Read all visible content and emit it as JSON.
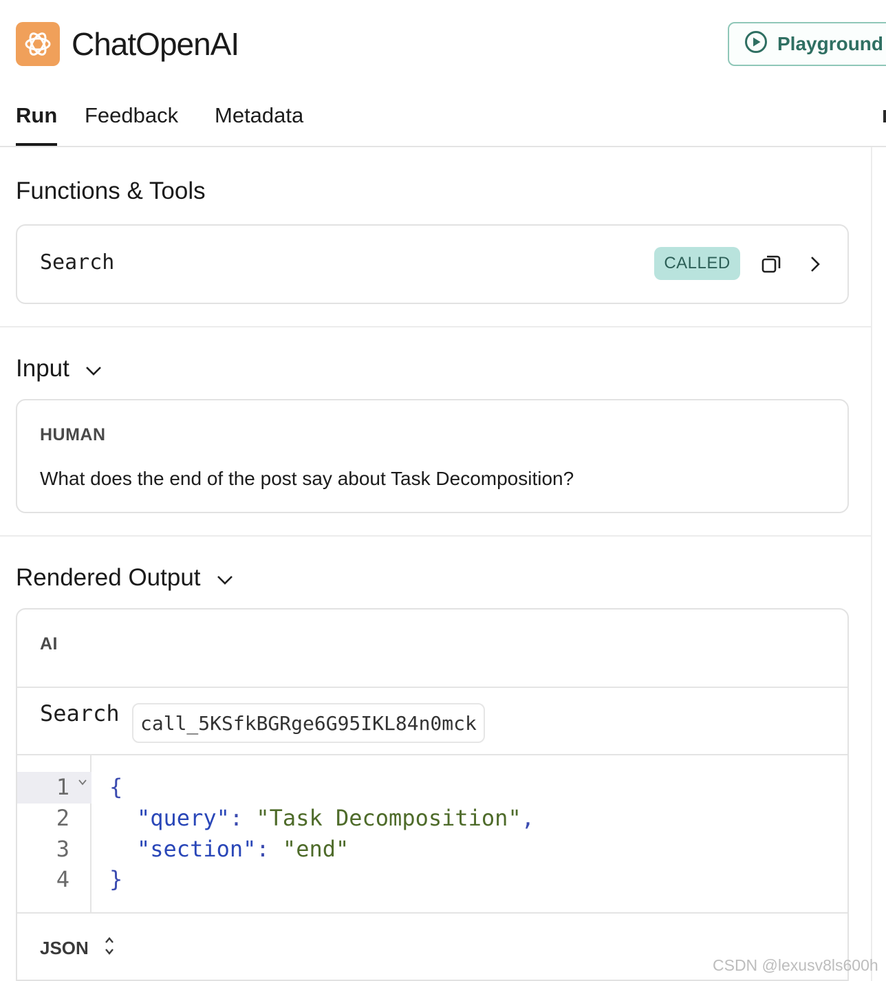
{
  "header": {
    "app_title": "ChatOpenAI",
    "logo_icon": "openai-logo-icon",
    "playground_label": "Playground",
    "playground_icon": "play-circle-icon"
  },
  "tabs": [
    {
      "label": "Run",
      "active": true
    },
    {
      "label": "Feedback",
      "active": false
    },
    {
      "label": "Metadata",
      "active": false
    }
  ],
  "functions_tools": {
    "title": "Functions & Tools",
    "tool": {
      "name": "Search",
      "badge": "CALLED",
      "copy_icon": "copy-icon",
      "expand_icon": "chevron-right-icon"
    }
  },
  "input": {
    "title": "Input",
    "message": {
      "role": "HUMAN",
      "text": "What does the end of the post say about Task Decomposition?"
    }
  },
  "rendered_output": {
    "title": "Rendered Output",
    "role": "AI",
    "tool_call": {
      "name": "Search",
      "id": "call_5KSfkBGRge6G95IKL84n0mck"
    },
    "code": {
      "line_numbers": [
        "1",
        "2",
        "3",
        "4"
      ],
      "open_brace": "{",
      "close_brace": "}",
      "query_key": "\"query\"",
      "query_value": "\"Task Decomposition\"",
      "section_key": "\"section\"",
      "section_value": "\"end\"",
      "colon": ": ",
      "comma": ","
    },
    "format": "JSON"
  },
  "colors": {
    "brand_logo_bg": "#f0a05a",
    "accent_green": "#2f6f62",
    "badge_bg": "#b9e3dd"
  },
  "watermark": "CSDN @lexusv8ls600h"
}
